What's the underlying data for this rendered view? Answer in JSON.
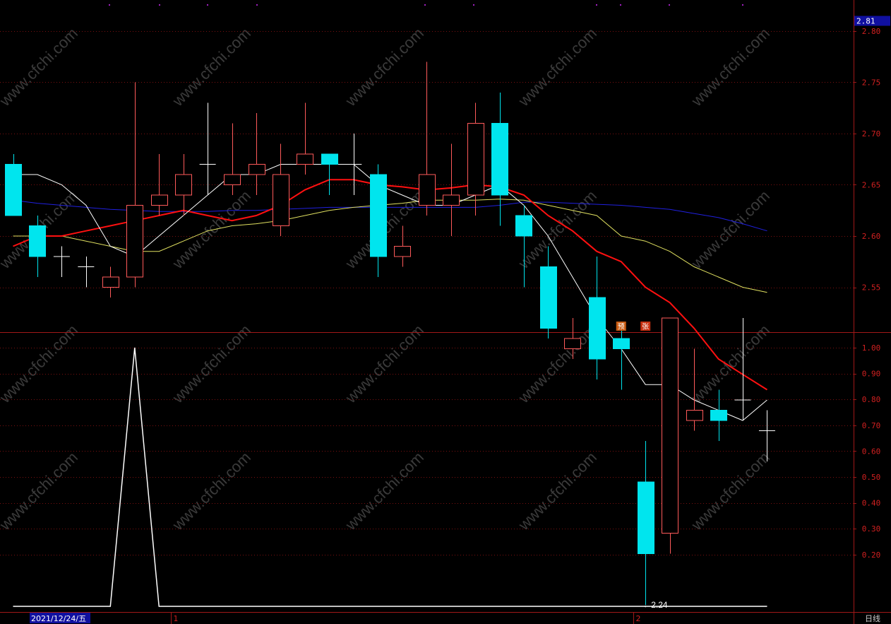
{
  "colors": {
    "background": "#000000",
    "frame": "#a01818",
    "grid": "#7a1010",
    "axis_text": "#d02020",
    "up_candle": "#ff5a5a",
    "down_candle": "#00e5ee",
    "doji": "#ffffff",
    "ma_white": "#ffffff",
    "ma_red": "#ff1010",
    "ma_yellow": "#e0e060",
    "ma_blue": "#2020e0",
    "indicator_line": "#ffffff",
    "price_tag_bg": "#1010a0",
    "date_tag_bg": "#1010a0"
  },
  "watermark": "www.cfchi.com",
  "price_tag": "2.81",
  "low_annotation": "←2.24",
  "badges": [
    {
      "text": "预",
      "color": "#c85a10",
      "index": 25
    },
    {
      "text": "张",
      "color": "#c83010",
      "index": 26
    }
  ],
  "bottom_axis": {
    "date_tag": "2021/12/24/五",
    "month_marks": [
      {
        "label": "1",
        "index": 7
      },
      {
        "label": "2",
        "index": 26
      }
    ],
    "period": "日线"
  },
  "chart_data": [
    {
      "type": "candlestick",
      "ylim": [
        2.21,
        2.85
      ],
      "yticks": [
        2.25,
        2.3,
        2.35,
        2.4,
        2.45,
        2.5,
        2.55,
        2.6,
        2.65,
        2.7,
        2.75,
        2.8,
        2.85
      ],
      "ohlc": [
        [
          2.67,
          2.68,
          2.62,
          2.62
        ],
        [
          2.61,
          2.62,
          2.56,
          2.58
        ],
        [
          2.58,
          2.59,
          2.56,
          2.58
        ],
        [
          2.57,
          2.58,
          2.55,
          2.57
        ],
        [
          2.55,
          2.57,
          2.54,
          2.56
        ],
        [
          2.56,
          2.75,
          2.55,
          2.63
        ],
        [
          2.63,
          2.68,
          2.62,
          2.64
        ],
        [
          2.64,
          2.68,
          2.62,
          2.66
        ],
        [
          2.67,
          2.73,
          2.64,
          2.67
        ],
        [
          2.65,
          2.71,
          2.64,
          2.66
        ],
        [
          2.66,
          2.72,
          2.64,
          2.67
        ],
        [
          2.61,
          2.69,
          2.6,
          2.66
        ],
        [
          2.67,
          2.73,
          2.66,
          2.68
        ],
        [
          2.68,
          2.68,
          2.64,
          2.67
        ],
        [
          2.67,
          2.7,
          2.64,
          2.67
        ],
        [
          2.66,
          2.67,
          2.56,
          2.58
        ],
        [
          2.58,
          2.61,
          2.57,
          2.59
        ],
        [
          2.63,
          2.77,
          2.62,
          2.66
        ],
        [
          2.63,
          2.69,
          2.6,
          2.64
        ],
        [
          2.64,
          2.73,
          2.62,
          2.71
        ],
        [
          2.71,
          2.74,
          2.61,
          2.64
        ],
        [
          2.62,
          2.63,
          2.55,
          2.6
        ],
        [
          2.57,
          2.59,
          2.5,
          2.51
        ],
        [
          2.49,
          2.52,
          2.48,
          2.5
        ],
        [
          2.54,
          2.58,
          2.46,
          2.48
        ],
        [
          2.5,
          2.51,
          2.45,
          2.49
        ],
        [
          2.36,
          2.4,
          2.24,
          2.29
        ],
        [
          2.31,
          2.52,
          2.29,
          2.52
        ],
        [
          2.42,
          2.49,
          2.41,
          2.43
        ],
        [
          2.43,
          2.45,
          2.4,
          2.42
        ],
        [
          2.44,
          2.52,
          2.42,
          2.44
        ],
        [
          2.41,
          2.43,
          2.38,
          2.41
        ]
      ],
      "ma_white": [
        2.66,
        2.66,
        2.65,
        2.63,
        2.59,
        2.58,
        2.6,
        2.62,
        2.64,
        2.66,
        2.66,
        2.67,
        2.67,
        2.67,
        2.67,
        2.65,
        2.64,
        2.63,
        2.63,
        2.64,
        2.65,
        2.63,
        2.6,
        2.56,
        2.52,
        2.49,
        2.455,
        2.455,
        2.44,
        2.43,
        2.42,
        2.44
      ],
      "ma_red": [
        2.59,
        2.6,
        2.6,
        2.605,
        2.61,
        2.615,
        2.62,
        2.625,
        2.62,
        2.615,
        2.62,
        2.63,
        2.645,
        2.655,
        2.655,
        2.65,
        2.648,
        2.645,
        2.647,
        2.65,
        2.648,
        2.64,
        2.62,
        2.605,
        2.585,
        2.575,
        2.55,
        2.535,
        2.51,
        2.48,
        2.465,
        2.45
      ],
      "ma_yellow": [
        2.6,
        2.6,
        2.6,
        2.595,
        2.59,
        2.585,
        2.585,
        2.595,
        2.605,
        2.61,
        2.612,
        2.615,
        2.62,
        2.625,
        2.628,
        2.63,
        2.632,
        2.635,
        2.635,
        2.635,
        2.636,
        2.635,
        2.63,
        2.625,
        2.62,
        2.6,
        2.595,
        2.585,
        2.57,
        2.56,
        2.55,
        2.545
      ],
      "ma_blue": [
        2.635,
        2.632,
        2.63,
        2.628,
        2.626,
        2.625,
        2.624,
        2.624,
        2.624,
        2.625,
        2.625,
        2.626,
        2.627,
        2.628,
        2.628,
        2.628,
        2.628,
        2.628,
        2.628,
        2.628,
        2.63,
        2.633,
        2.633,
        2.632,
        2.631,
        2.63,
        2.628,
        2.626,
        2.622,
        2.618,
        2.612,
        2.605
      ]
    },
    {
      "type": "line",
      "ylim": [
        0.1,
        1.05
      ],
      "yticks": [
        0.2,
        0.3,
        0.4,
        0.5,
        0.6,
        0.7,
        0.8,
        0.9,
        1.0
      ],
      "values": [
        0,
        0,
        0,
        0,
        0,
        1,
        0,
        0,
        0,
        0,
        0,
        0,
        0,
        0,
        0,
        0,
        0,
        0,
        0,
        0,
        0,
        0,
        0,
        0,
        0,
        0,
        0,
        0,
        0,
        0,
        0,
        0
      ]
    }
  ]
}
